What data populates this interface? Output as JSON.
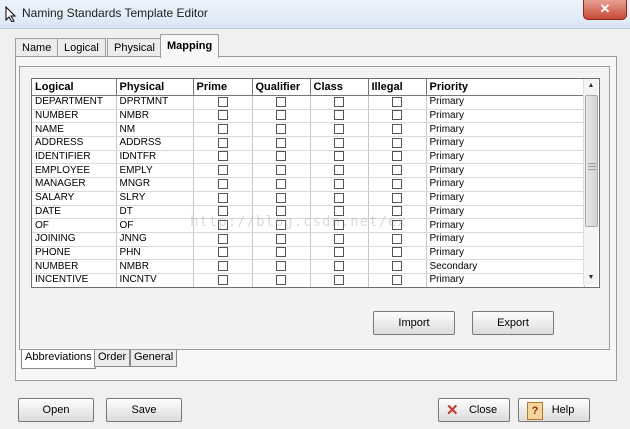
{
  "window": {
    "title": "Naming Standards Template Editor",
    "close_glyph": "✕"
  },
  "tabs": [
    {
      "label": "Name"
    },
    {
      "label": "Logical"
    },
    {
      "label": "Physical"
    },
    {
      "label": "Mapping",
      "active": true
    }
  ],
  "grid": {
    "columns": [
      "Logical",
      "Physical",
      "Prime",
      "Qualifier",
      "Class",
      "Illegal",
      "Priority"
    ],
    "rows": [
      {
        "logical": "DEPARTMENT",
        "physical": "DPRTMNT",
        "priority": "Primary"
      },
      {
        "logical": "NUMBER",
        "physical": "NMBR",
        "priority": "Primary"
      },
      {
        "logical": "NAME",
        "physical": "NM",
        "priority": "Primary"
      },
      {
        "logical": "ADDRESS",
        "physical": "ADDRSS",
        "priority": "Primary"
      },
      {
        "logical": "IDENTIFIER",
        "physical": "IDNTFR",
        "priority": "Primary"
      },
      {
        "logical": "EMPLOYEE",
        "physical": "EMPLY",
        "priority": "Primary"
      },
      {
        "logical": "MANAGER",
        "physical": "MNGR",
        "priority": "Primary"
      },
      {
        "logical": "SALARY",
        "physical": "SLRY",
        "priority": "Primary"
      },
      {
        "logical": "DATE",
        "physical": "DT",
        "priority": "Primary"
      },
      {
        "logical": "OF",
        "physical": "OF",
        "priority": "Primary"
      },
      {
        "logical": "JOINING",
        "physical": "JNNG",
        "priority": "Primary"
      },
      {
        "logical": "PHONE",
        "physical": "PHN",
        "priority": "Primary"
      },
      {
        "logical": "NUMBER",
        "physical": "NMBR",
        "priority": "Secondary"
      },
      {
        "logical": "INCENTIVE",
        "physical": "INCNTV",
        "priority": "Primary"
      }
    ]
  },
  "watermark": "http://blog.csdn.net/ex",
  "buttons": {
    "import": "Import",
    "export": "Export",
    "open": "Open",
    "save": "Save",
    "close": "Close",
    "help": "Help"
  },
  "subtabs": [
    {
      "label": "Abbreviations",
      "active": true
    },
    {
      "label": "Order"
    },
    {
      "label": "General"
    }
  ],
  "colors": {
    "close_button": "#c74a35",
    "titlebar": "#dbe6f4"
  }
}
